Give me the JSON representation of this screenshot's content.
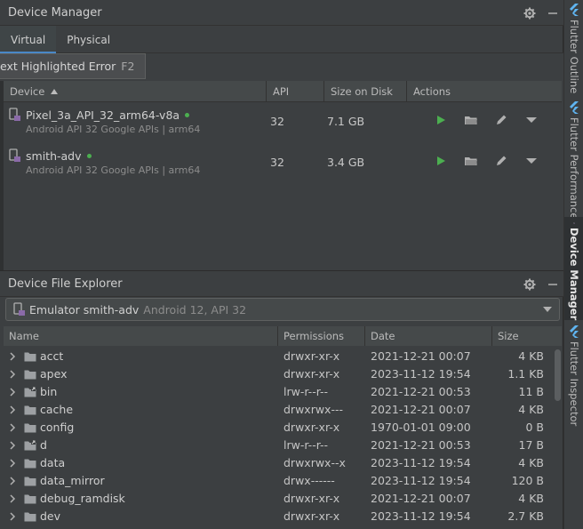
{
  "device_manager": {
    "title": "Device Manager",
    "tabs": [
      {
        "label": "Virtual",
        "active": true
      },
      {
        "label": "Physical",
        "active": false
      }
    ],
    "tooltip": {
      "text": "ext Highlighted Error",
      "shortcut": "F2"
    },
    "columns": [
      "Device",
      "API",
      "Size on Disk",
      "Actions"
    ],
    "devices": [
      {
        "name": "Pixel_3a_API_32_arm64-v8a",
        "subtitle": "Android API 32 Google APIs | arm64",
        "api": "32",
        "size": "7.1 GB",
        "online": true
      },
      {
        "name": "smith-adv",
        "subtitle": "Android API 32 Google APIs | arm64",
        "api": "32",
        "size": "3.4 GB",
        "online": true
      }
    ]
  },
  "device_file_explorer": {
    "title": "Device File Explorer",
    "selected_device": {
      "name": "Emulator smith-adv",
      "detail": "Android 12, API 32"
    },
    "columns": [
      "Name",
      "Permissions",
      "Date",
      "Size"
    ],
    "files": [
      {
        "name": "acct",
        "perm": "drwxr-xr-x",
        "date": "2021-12-21 00:07",
        "size": "4 KB",
        "link": false
      },
      {
        "name": "apex",
        "perm": "drwxr-xr-x",
        "date": "2023-11-12 19:54",
        "size": "1.1 KB",
        "link": false
      },
      {
        "name": "bin",
        "perm": "lrw-r--r--",
        "date": "2021-12-21 00:53",
        "size": "11 B",
        "link": true
      },
      {
        "name": "cache",
        "perm": "drwxrwx---",
        "date": "2021-12-21 00:07",
        "size": "4 KB",
        "link": false
      },
      {
        "name": "config",
        "perm": "drwxr-xr-x",
        "date": "1970-01-01 09:00",
        "size": "0 B",
        "link": false
      },
      {
        "name": "d",
        "perm": "lrw-r--r--",
        "date": "2021-12-21 00:53",
        "size": "17 B",
        "link": true
      },
      {
        "name": "data",
        "perm": "drwxrwx--x",
        "date": "2023-11-12 19:54",
        "size": "4 KB",
        "link": false
      },
      {
        "name": "data_mirror",
        "perm": "drwx------",
        "date": "2023-11-12 19:54",
        "size": "120 B",
        "link": false
      },
      {
        "name": "debug_ramdisk",
        "perm": "drwxr-xr-x",
        "date": "2021-12-21 00:07",
        "size": "4 KB",
        "link": false
      },
      {
        "name": "dev",
        "perm": "drwxr-xr-x",
        "date": "2023-11-12 19:54",
        "size": "2.7 KB",
        "link": false
      },
      {
        "name": "",
        "perm": "",
        "date": "",
        "size": "",
        "link": true
      }
    ]
  },
  "side_tabs": [
    {
      "label": "Flutter Outline",
      "active": false
    },
    {
      "label": "Flutter Performance",
      "active": false
    },
    {
      "label": "Device Manager",
      "active": true
    },
    {
      "label": "Flutter Inspector",
      "active": false
    }
  ],
  "colors": {
    "accent": "#4a88c7",
    "run": "#4caf50",
    "panel": "#3c3f41",
    "flutter": "#5fb4f0"
  }
}
